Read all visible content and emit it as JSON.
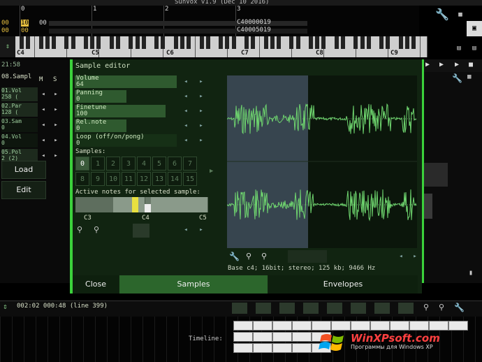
{
  "window": {
    "title": "SunVox v1.9 (Dec 10 2016)"
  },
  "timeline_top": {
    "markers": [
      "0",
      "1",
      "2",
      "3"
    ],
    "rows": [
      {
        "cells": [
          "00",
          "10",
          "00"
        ]
      },
      {
        "cells": [
          "00",
          "00"
        ]
      }
    ],
    "notes": [
      "C40000019",
      "C40005019"
    ]
  },
  "piano": {
    "labels": [
      "C4",
      "C5",
      "C6",
      "C7",
      "C8",
      "C9"
    ]
  },
  "left": {
    "time": "21:58",
    "header": [
      "08.Sampl",
      "M",
      "S"
    ],
    "modules": [
      {
        "name": "01.Vol",
        "sub": "258 ("
      },
      {
        "name": "02.Par",
        "sub": "128 ("
      },
      {
        "name": "03.Sam",
        "sub": "0"
      },
      {
        "name": "04.Vol",
        "sub": "0"
      },
      {
        "name": "05.Pol",
        "sub": "2 (2)"
      }
    ],
    "load_label": "Load",
    "edit_label": "Edit"
  },
  "editor": {
    "title": "Sample editor",
    "params": [
      {
        "name": "Volume",
        "value": "64"
      },
      {
        "name": "Panning",
        "value": "0"
      },
      {
        "name": "Finetune",
        "value": "100"
      },
      {
        "name": "Rel.note",
        "value": "0"
      },
      {
        "name": "Loop (off/on/pong)",
        "value": "0"
      }
    ],
    "samples_label": "Samples:",
    "slots": [
      "0",
      "1",
      "2",
      "3",
      "4",
      "5",
      "6",
      "7",
      "8",
      "9",
      "10",
      "11",
      "12",
      "13",
      "14",
      "15"
    ],
    "active_notes_label": "Active notes for selected sample:",
    "key_labels": [
      "C3",
      "C4",
      "C5"
    ],
    "info": "Base c4; 16bit; stereo; 125 kb; 9466 Hz",
    "tabs": {
      "close": "Close",
      "samples": "Samples",
      "envelopes": "Envelopes"
    }
  },
  "bottom": {
    "time": "002:02  000:48  (line 399)",
    "timeline_label": "Timeline:"
  },
  "watermark": {
    "title": "WinXPsoft.com",
    "subtitle": "Программы для Windows XP"
  },
  "colors": {
    "accent": "#3bd13b",
    "panel": "#112411",
    "param": "#2f5a2f",
    "wave": "#6fd66f"
  }
}
